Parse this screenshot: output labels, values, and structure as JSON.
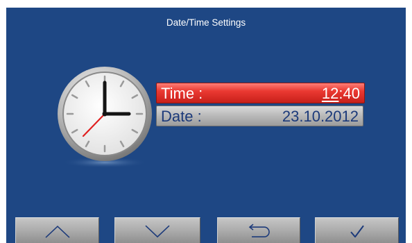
{
  "screen": {
    "title": "Date/Time Settings"
  },
  "fields": {
    "time": {
      "label": "Time :",
      "hour": "12",
      "separator": ":",
      "minute": "40"
    },
    "date": {
      "label": "Date :",
      "value": "23.10.2012"
    }
  },
  "toolbar": {
    "buttons": [
      {
        "icon": "chevron-up-icon"
      },
      {
        "icon": "chevron-down-icon"
      },
      {
        "icon": "return-arrow-icon"
      },
      {
        "icon": "checkmark-icon"
      }
    ]
  },
  "colors": {
    "background": "#1e4784",
    "selected_row": "#ea3932",
    "row": "#b8b8b8",
    "button": "#a9a9a9",
    "text_dark": "#1c3a7a",
    "clock_second_hand": "#e02020"
  }
}
